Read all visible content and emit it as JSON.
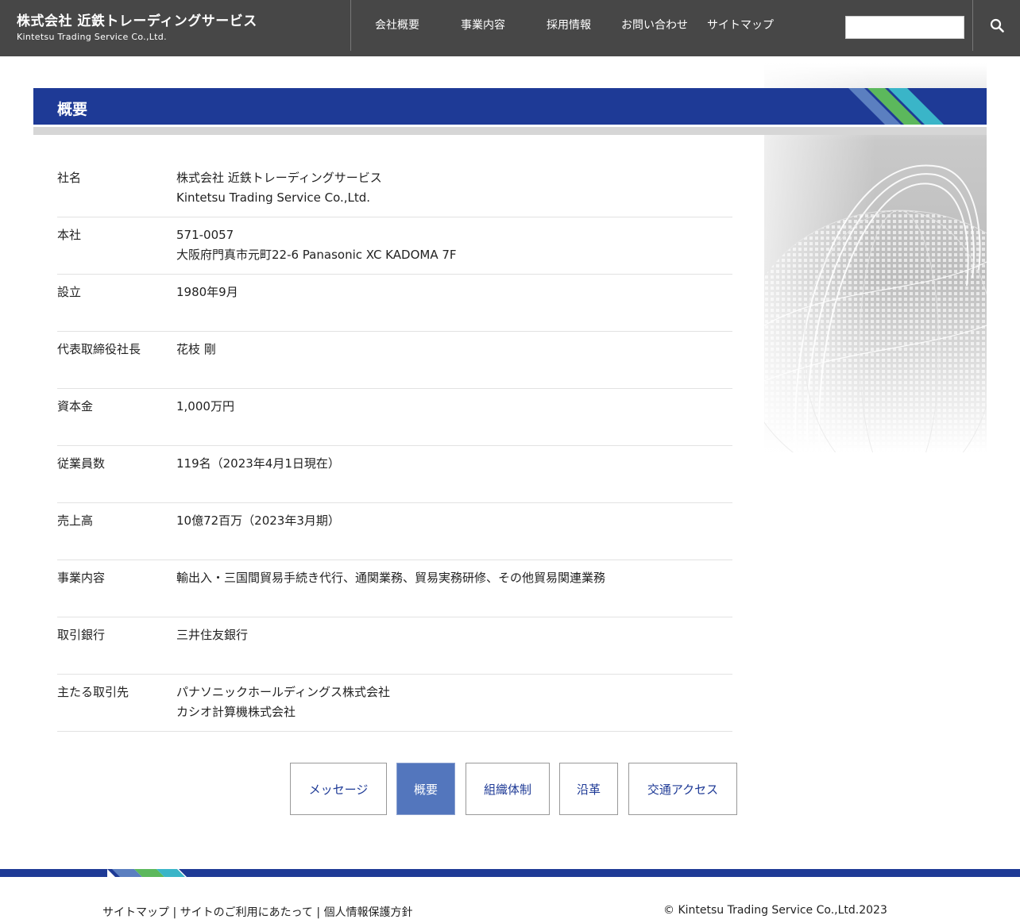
{
  "header": {
    "logo_ja": "株式会社 近鉄トレーディングサービス",
    "logo_en": "Kintetsu Trading Service Co.,Ltd.",
    "nav": [
      "会社概要",
      "事業内容",
      "採用情報",
      "お問い合わせ",
      "サイトマップ"
    ],
    "search_value": ""
  },
  "page": {
    "title": "概要"
  },
  "company_info": [
    {
      "label": "社名",
      "values": [
        "株式会社 近鉄トレーディングサービス",
        "Kintetsu Trading Service Co.,Ltd."
      ]
    },
    {
      "label": "本社",
      "values": [
        "571-0057",
        "大阪府門真市元町22-6 Panasonic XC KADOMA 7F"
      ]
    },
    {
      "label": "設立",
      "values": [
        "1980年9月"
      ]
    },
    {
      "label": "代表取締役社長",
      "values": [
        "花枝 剛"
      ]
    },
    {
      "label": "資本金",
      "values": [
        "1,000万円"
      ]
    },
    {
      "label": "従業員数",
      "values": [
        "119名（2023年4月1日現在）"
      ]
    },
    {
      "label": "売上高",
      "values": [
        "10億72百万（2023年3月期）"
      ]
    },
    {
      "label": "事業内容",
      "values": [
        "輸出入・三国間貿易手続き代行、通関業務、貿易実務研修、その他貿易関連業務"
      ]
    },
    {
      "label": "取引銀行",
      "values": [
        "三井住友銀行"
      ]
    },
    {
      "label": "主たる取引先",
      "values": [
        "パナソニックホールディングス株式会社",
        "カシオ計算機株式会社"
      ]
    }
  ],
  "subnav": {
    "items": [
      "メッセージ",
      "概要",
      "組織体制",
      "沿革",
      "交通アクセス"
    ],
    "active": "概要"
  },
  "footer": {
    "links": [
      "サイトマップ",
      "サイトのご利用にあたって",
      "個人情報保護方針"
    ],
    "separator": " | ",
    "copyright": "© Kintetsu Trading Service Co.,Ltd.2023"
  },
  "colors": {
    "header_bg": "#474747",
    "brand_blue": "#1e3a96",
    "active_tab": "#5376bd",
    "stripe_blue": "#5b7fc0",
    "stripe_green": "#5cb85c",
    "stripe_teal": "#3ab5c8"
  },
  "icons": {
    "search": "search-icon"
  }
}
